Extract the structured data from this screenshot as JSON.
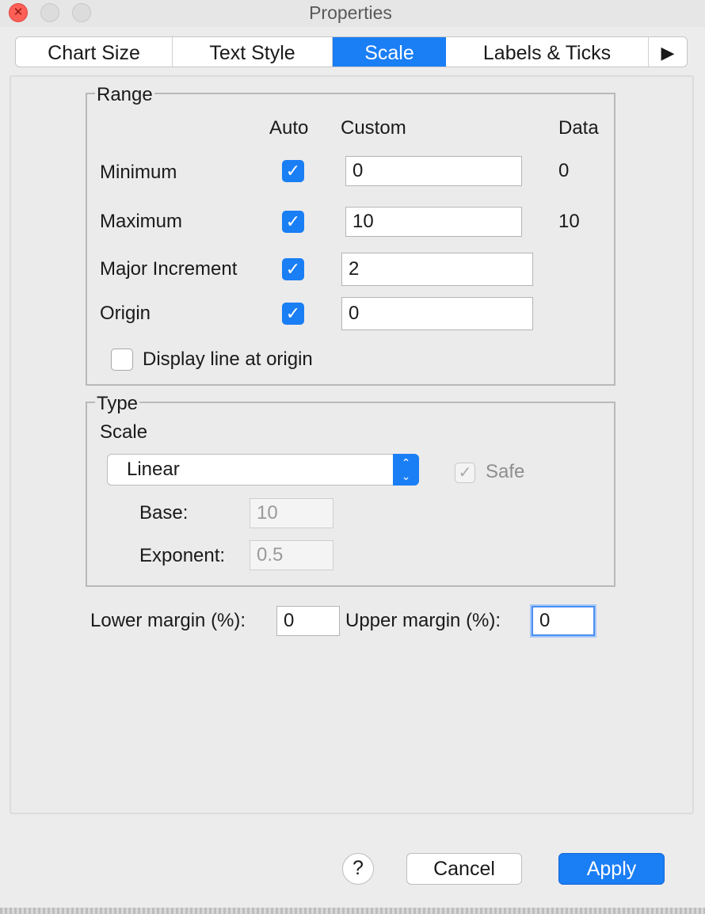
{
  "window": {
    "title": "Properties",
    "close_glyph": "✕"
  },
  "tabs": [
    {
      "label": "Chart Size"
    },
    {
      "label": "Text Style"
    },
    {
      "label": "Scale",
      "selected": true
    },
    {
      "label": "Labels & Ticks"
    },
    {
      "label": "▶"
    }
  ],
  "range": {
    "legend": "Range",
    "headers": {
      "auto": "Auto",
      "custom": "Custom",
      "data": "Data"
    },
    "rows": [
      {
        "label": "Minimum",
        "auto": true,
        "custom": "0",
        "data": "0"
      },
      {
        "label": "Maximum",
        "auto": true,
        "custom": "10",
        "data": "10"
      },
      {
        "label": "Major Increment",
        "auto": true,
        "custom": "2",
        "data": ""
      },
      {
        "label": "Origin",
        "auto": true,
        "custom": "0",
        "data": ""
      }
    ],
    "display_line_label": "Display line at origin",
    "display_line_checked": false
  },
  "type": {
    "legend": "Type",
    "scale_label": "Scale",
    "scale_value": "Linear",
    "safe_label": "Safe",
    "safe_checked": true,
    "base_label": "Base:",
    "base_value": "10",
    "exponent_label": "Exponent:",
    "exponent_value": "0.5"
  },
  "margins": {
    "lower_label": "Lower margin (%):",
    "lower_value": "0",
    "upper_label": "Upper margin (%):",
    "upper_value": "0"
  },
  "buttons": {
    "help": "?",
    "cancel": "Cancel",
    "apply": "Apply"
  },
  "checkmark": "✓",
  "select_arrows": "⌃⌄",
  "colors": {
    "accent": "#1a7ef5",
    "close": "#fe5f57"
  }
}
